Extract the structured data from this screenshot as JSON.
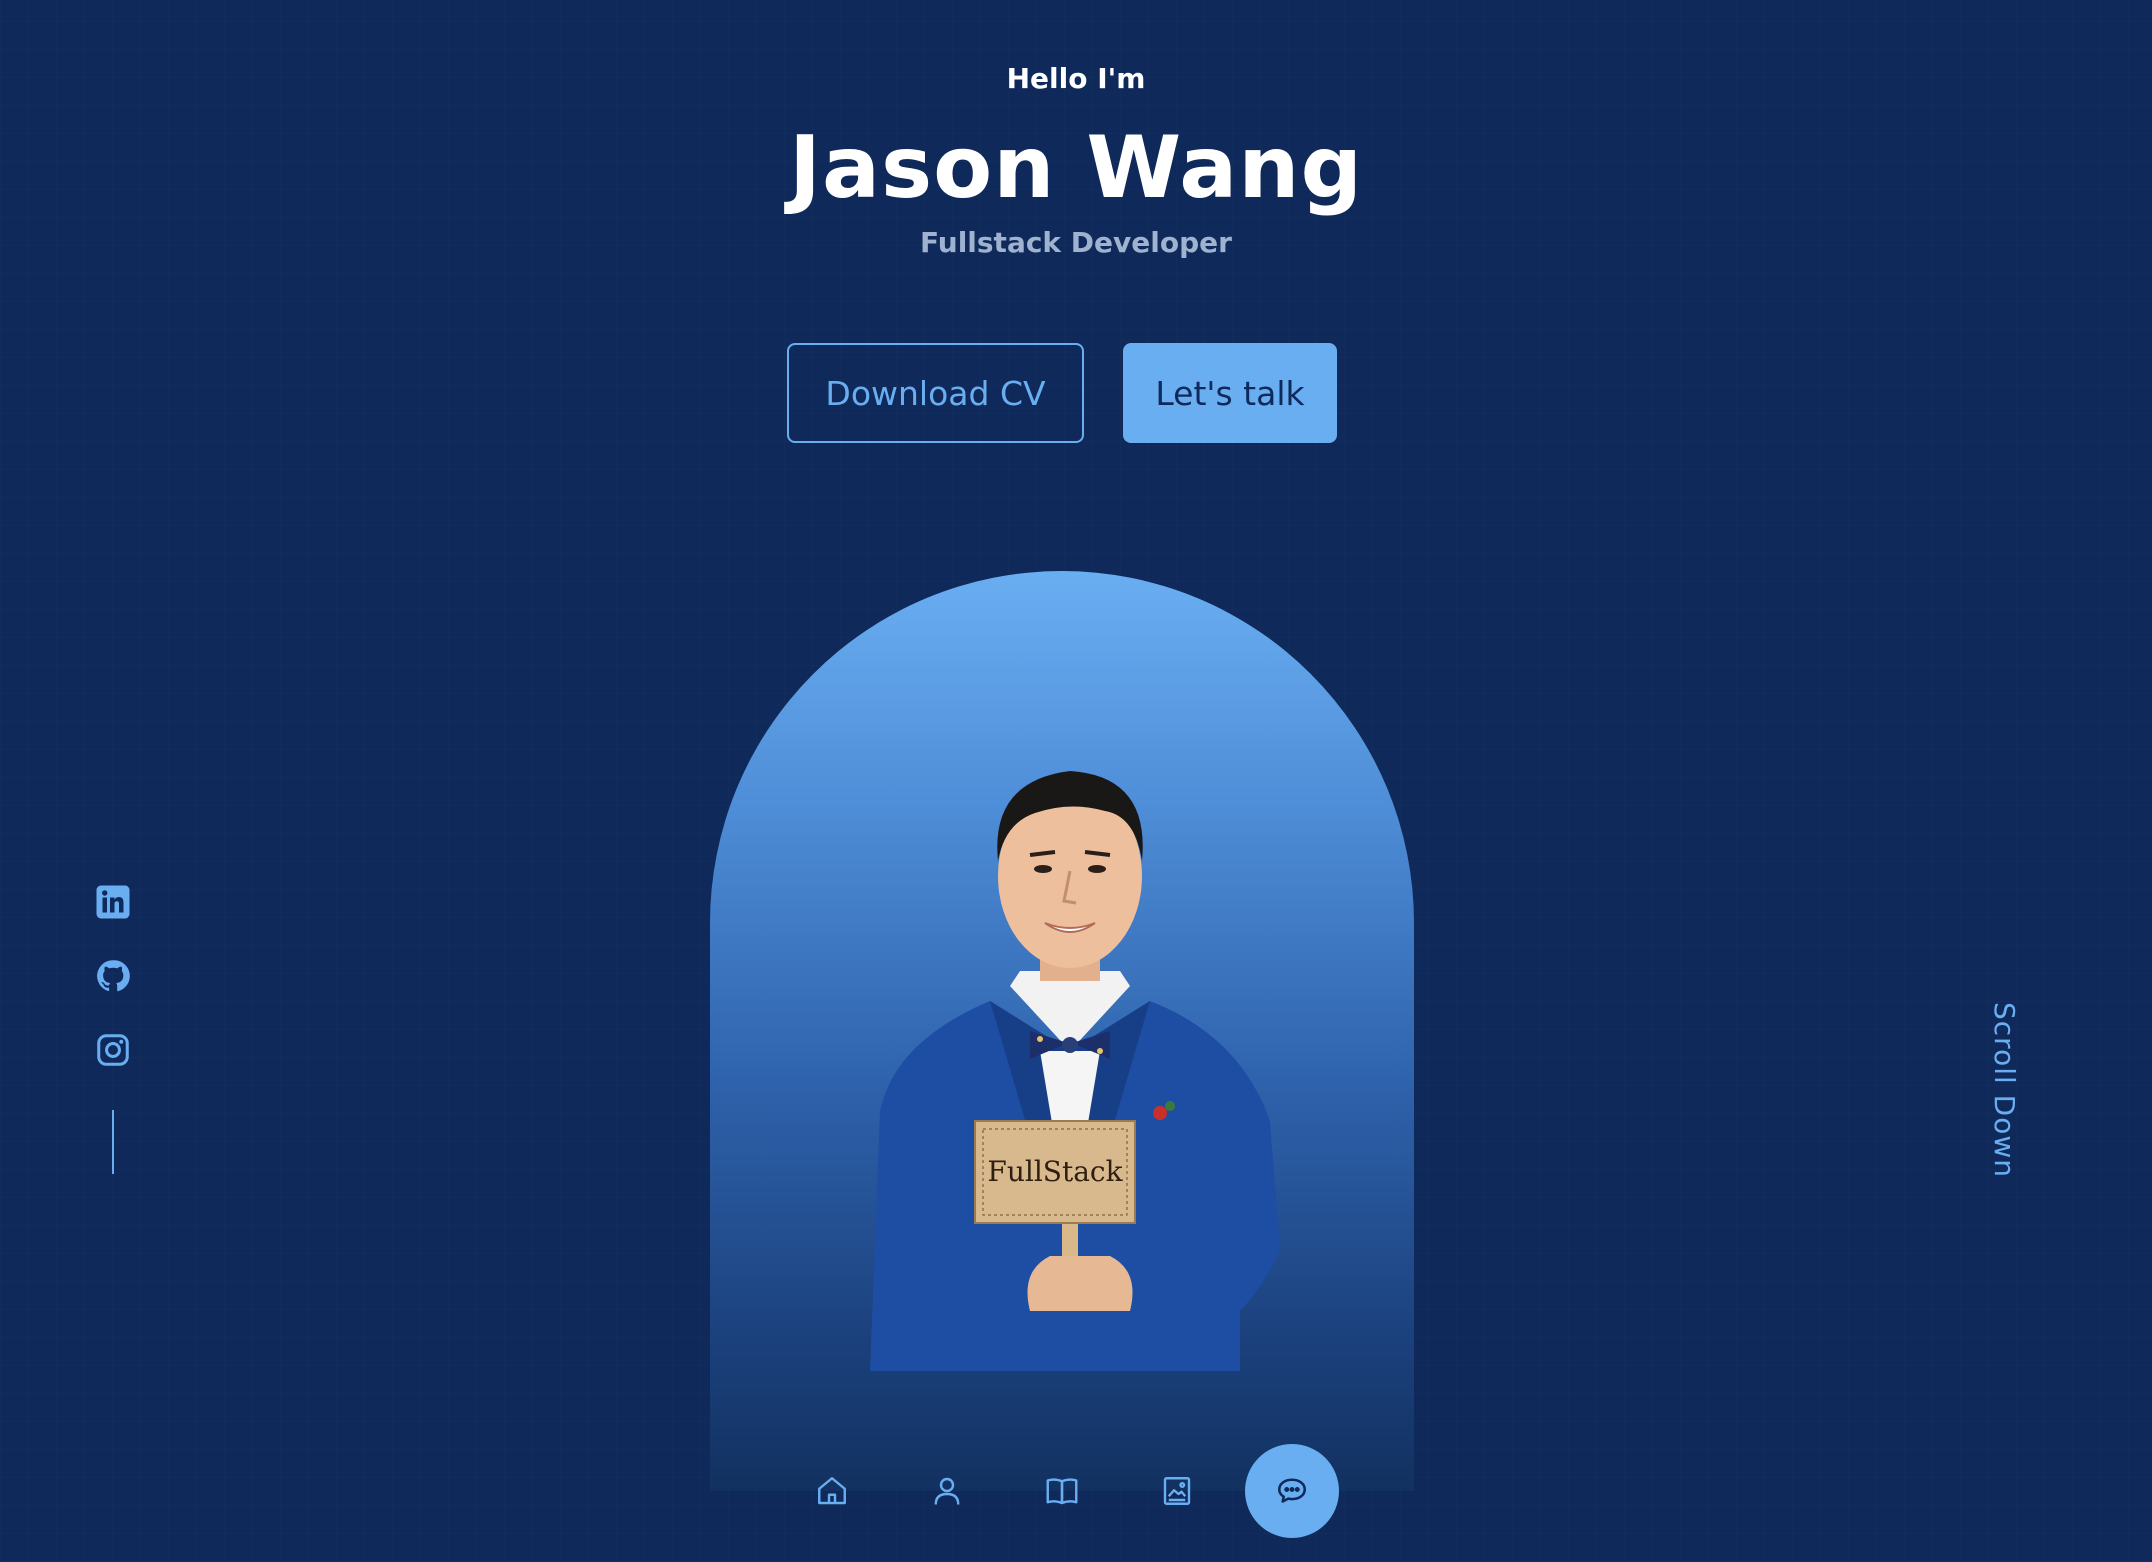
{
  "hero": {
    "greeting": "Hello I'm",
    "name": "Jason Wang",
    "role": "Fullstack Developer"
  },
  "actions": {
    "download_cv_label": "Download CV",
    "lets_talk_label": "Let's talk"
  },
  "portrait": {
    "sign_text": "FullStack"
  },
  "social": {
    "items": [
      {
        "icon": "linkedin-icon"
      },
      {
        "icon": "github-icon"
      },
      {
        "icon": "instagram-icon"
      }
    ]
  },
  "scroll": {
    "label": "Scroll Down"
  },
  "nav": {
    "items": [
      {
        "icon": "home-icon",
        "active": false
      },
      {
        "icon": "user-icon",
        "active": false
      },
      {
        "icon": "book-icon",
        "active": false
      },
      {
        "icon": "image-icon",
        "active": false
      },
      {
        "icon": "chat-icon",
        "active": true
      }
    ]
  },
  "colors": {
    "background": "#0f2a5a",
    "accent": "#6aaef2",
    "muted_text": "#9fb2cf"
  }
}
